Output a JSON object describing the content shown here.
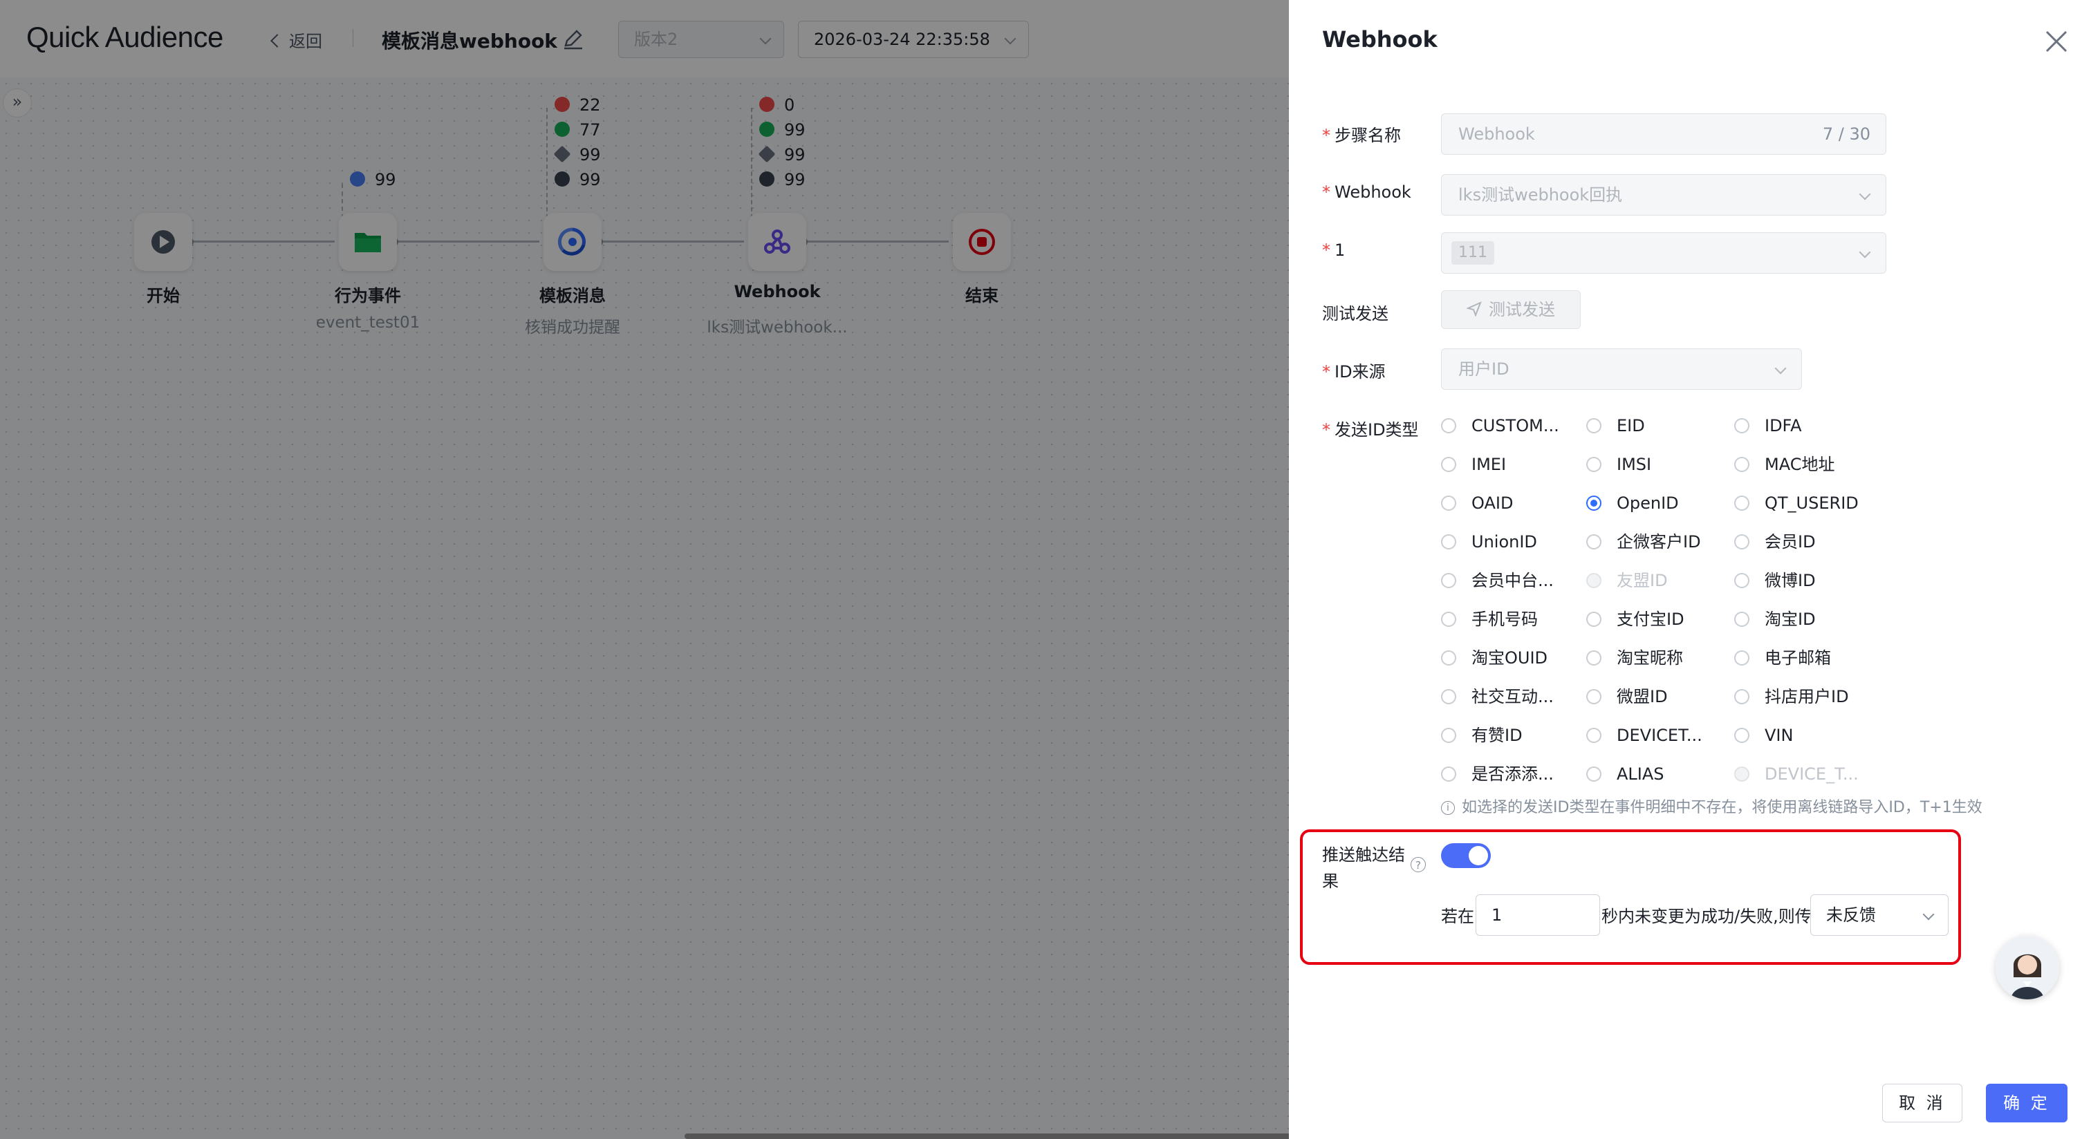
{
  "header": {
    "logo": "Quick Audience",
    "back_label": "返回",
    "canvas_title": "模板消息webhook",
    "version_select": "版本2",
    "datetime_select": "2026-03-24 22:35:58"
  },
  "flow": {
    "nodes": [
      {
        "label": "开始",
        "sub": "",
        "icon": "play-icon",
        "color": "#4e5969"
      },
      {
        "label": "行为事件",
        "sub": "event_test01",
        "icon": "folder-icon",
        "color": "#00a854"
      },
      {
        "label": "模板消息",
        "sub": "核销成功提醒",
        "icon": "template-message-icon",
        "color": "#2f6bff"
      },
      {
        "label": "Webhook",
        "sub": "lks测试webhook...",
        "icon": "webhook-icon",
        "color": "#6a4cf5"
      },
      {
        "label": "结束",
        "sub": "",
        "icon": "stop-icon",
        "color": "#e60012"
      }
    ],
    "event_stats": [
      {
        "icon": "people-icon",
        "value": "99"
      }
    ],
    "template_stats": [
      {
        "icon": "fail-icon",
        "value": "22"
      },
      {
        "icon": "success-icon",
        "value": "77"
      },
      {
        "icon": "sent-icon",
        "value": "99"
      },
      {
        "icon": "received-icon",
        "value": "99"
      }
    ],
    "webhook_stats": [
      {
        "icon": "fail-icon",
        "value": "0"
      },
      {
        "icon": "success-icon",
        "value": "99"
      },
      {
        "icon": "sent-icon",
        "value": "99"
      },
      {
        "icon": "received-icon",
        "value": "99"
      }
    ]
  },
  "drawer": {
    "title": "Webhook",
    "step_name_label": "步骤名称",
    "step_name_value": "Webhook",
    "step_name_counter": "7 / 30",
    "webhook_label": "Webhook",
    "webhook_value": "lks测试webhook回执",
    "param_label": "1",
    "param_tag": "111",
    "test_send_label": "测试发送",
    "test_send_button": "测试发送",
    "id_source_label": "ID来源",
    "id_source_value": "用户ID",
    "id_type_label": "发送ID类型",
    "id_types": [
      [
        "CUSTOM...",
        "EID",
        "IDFA"
      ],
      [
        "IMEI",
        "IMSI",
        "MAC地址"
      ],
      [
        "OAID",
        "OpenID",
        "QT_USERID"
      ],
      [
        "UnionID",
        "企微客户ID",
        "会员ID"
      ],
      [
        "会员中台...",
        "友盟ID",
        "微博ID"
      ],
      [
        "手机号码",
        "支付宝ID",
        "淘宝ID"
      ],
      [
        "淘宝OUID",
        "淘宝昵称",
        "电子邮箱"
      ],
      [
        "社交互动...",
        "微盟ID",
        "抖店用户ID"
      ],
      [
        "有赞ID",
        "DEVICET...",
        "VIN"
      ],
      [
        "是否添添...",
        "ALIAS",
        "DEVICE_T..."
      ]
    ],
    "id_type_selected": "OpenID",
    "id_type_disabled": [
      "友盟ID",
      "DEVICE_T..."
    ],
    "id_hint": "如选择的发送ID类型在事件明细中不存在，将使用离线链路导入ID，T+1生效",
    "push_result_label": "推送触达结果",
    "push_result_enabled": true,
    "if_text": "若在",
    "seconds_value": "1",
    "then_text": "秒内未变更为成功/失败,则传",
    "feedback_value": "未反馈",
    "cancel_button": "取 消",
    "ok_button": "确 定"
  },
  "colors": {
    "primary": "#4a6cf7",
    "highlight": "#e60012"
  }
}
